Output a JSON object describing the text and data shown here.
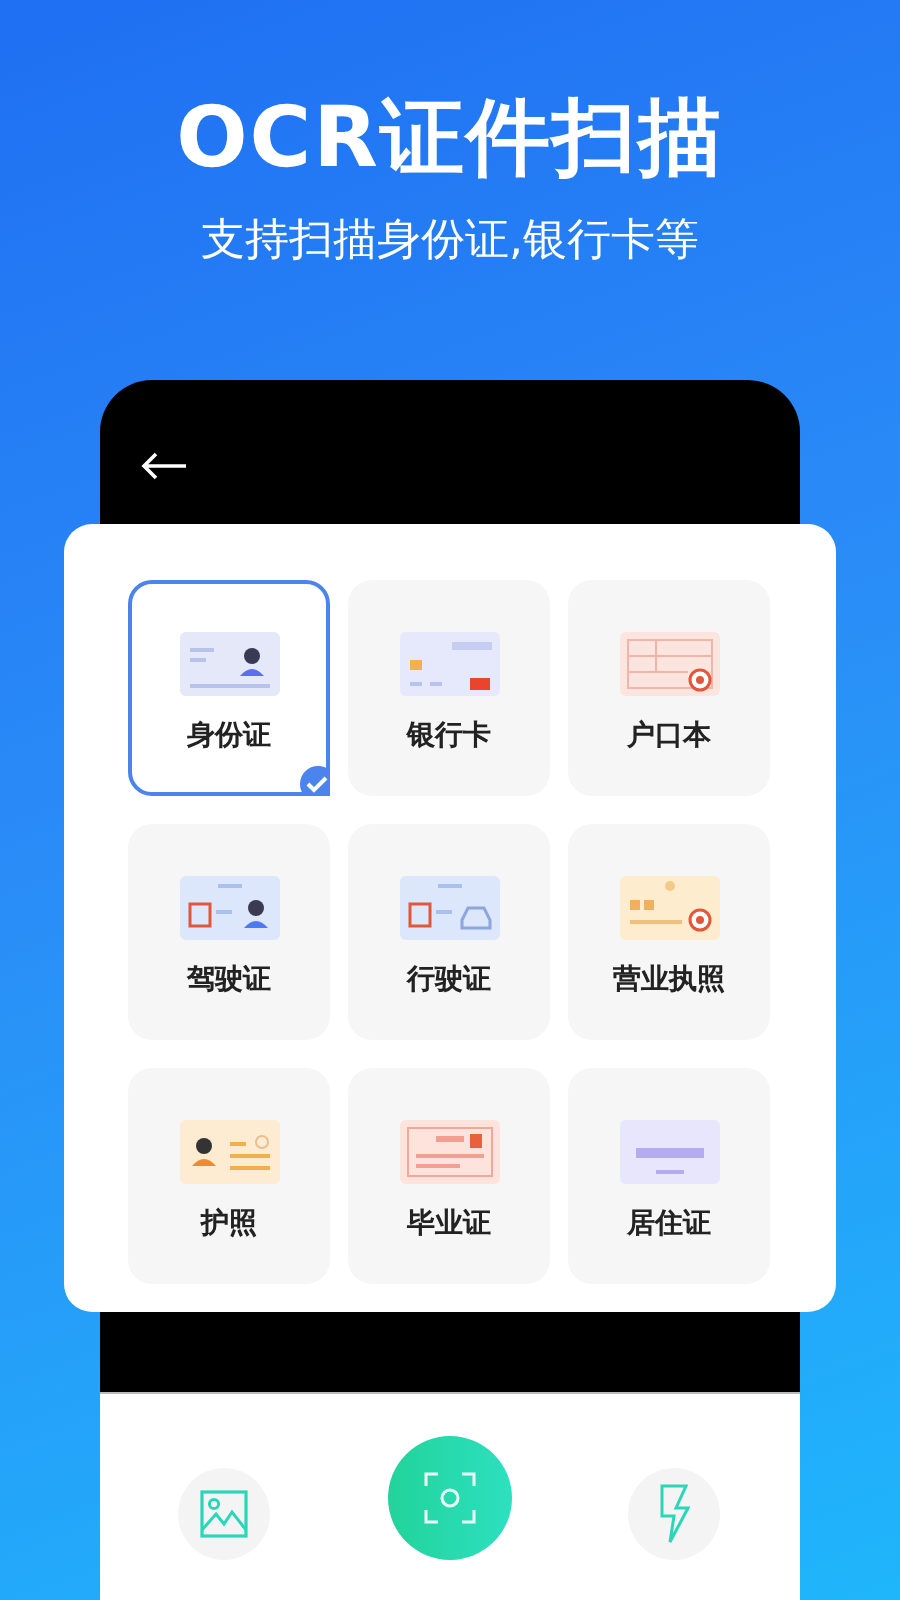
{
  "headline": {
    "title": "OCR证件扫描",
    "subtitle": "支持扫描身份证,银行卡等"
  },
  "documents": [
    {
      "label": "身份证",
      "kind": "id",
      "selected": true
    },
    {
      "label": "银行卡",
      "kind": "bank",
      "selected": false
    },
    {
      "label": "户口本",
      "kind": "household",
      "selected": false
    },
    {
      "label": "驾驶证",
      "kind": "driver",
      "selected": false
    },
    {
      "label": "行驶证",
      "kind": "vehicle",
      "selected": false
    },
    {
      "label": "营业执照",
      "kind": "business",
      "selected": false
    },
    {
      "label": "护照",
      "kind": "passport",
      "selected": false
    },
    {
      "label": "毕业证",
      "kind": "diploma",
      "selected": false
    },
    {
      "label": "居住证",
      "kind": "residence",
      "selected": false
    }
  ]
}
